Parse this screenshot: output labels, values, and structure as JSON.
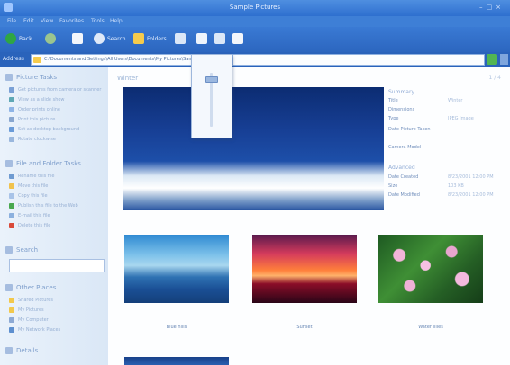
{
  "window": {
    "title": "Sample Pictures"
  },
  "menubar": {
    "items": [
      "File",
      "Edit",
      "View",
      "Favorites",
      "Tools",
      "Help"
    ]
  },
  "toolbar": {
    "back_label": "Back",
    "search_label": "Search",
    "folders_label": "Folders"
  },
  "address": {
    "label": "Address",
    "path": "C:\\Documents and Settings\\All Users\\Documents\\My Pictures\\Sample Pictures"
  },
  "taskpane": {
    "picture_tasks": {
      "title": "Picture Tasks",
      "items": [
        "Get pictures from camera or scanner",
        "View as a slide show",
        "Order prints online",
        "Print this picture",
        "Set as desktop background",
        "Rotate clockwise"
      ]
    },
    "file_tasks": {
      "title": "File and Folder Tasks",
      "items": [
        "Rename this file",
        "Move this file",
        "Copy this file",
        "Publish this file to the Web",
        "E-mail this file",
        "Delete this file"
      ]
    },
    "search": {
      "title": "Search",
      "placeholder": ""
    },
    "other_places": {
      "title": "Other Places",
      "items": [
        "Shared Pictures",
        "My Pictures",
        "My Computer",
        "My Network Places"
      ]
    },
    "details": {
      "title": "Details"
    }
  },
  "main": {
    "title": "Winter",
    "count_label": "1 / 4",
    "properties": {
      "header1": "Summary",
      "header2": "Advanced",
      "rows1": [
        {
          "k": "Title",
          "v": "Winter"
        },
        {
          "k": "Dimensions",
          "v": ""
        },
        {
          "k": "Type",
          "v": "JPEG Image"
        },
        {
          "k": "Date Picture Taken",
          "v": ""
        },
        {
          "k": "Camera Model",
          "v": ""
        }
      ],
      "rows2": [
        {
          "k": "Date Created",
          "v": "8/23/2001 12:00 PM"
        },
        {
          "k": "Size",
          "v": "103 KB"
        },
        {
          "k": "Date Modified",
          "v": "8/23/2001 12:00 PM"
        }
      ]
    },
    "thumbnails": [
      {
        "label": "Blue hills"
      },
      {
        "label": "Sunset"
      },
      {
        "label": "Water lilies"
      }
    ]
  },
  "colors": {
    "titlebar": "#2e6fcf",
    "toolbar": "#3a7ad4",
    "taskpane": "#e1ecf8",
    "main": "#fdfeff"
  }
}
